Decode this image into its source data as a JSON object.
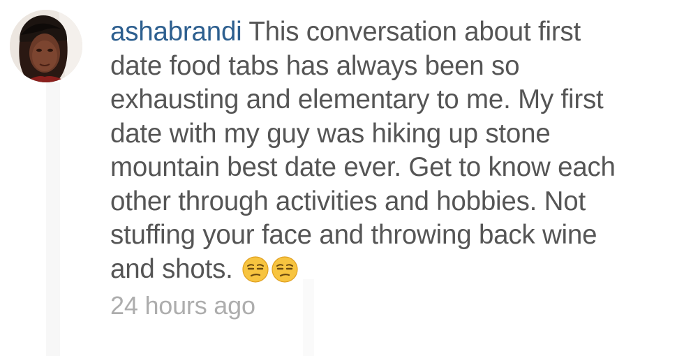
{
  "comment": {
    "username": "ashabrandi",
    "text_lines": [
      "This conversation about first",
      "date food tabs has always been so",
      "exhausting and elementary to me. My first",
      "date with my guy was hiking up stone",
      "mountain best date ever. Get to know each",
      "other through activities and hobbies. Not",
      "stuffing your face and throwing back wine",
      "and shots."
    ],
    "emojis": [
      "unamused-face-icon",
      "unamused-face-icon"
    ],
    "timestamp": "24 hours ago",
    "avatar_icon": "user-avatar-photo"
  },
  "colors": {
    "username": "#2d5f8f",
    "text": "#555555",
    "timestamp": "#adadad",
    "emoji_face": "#f7c440"
  }
}
